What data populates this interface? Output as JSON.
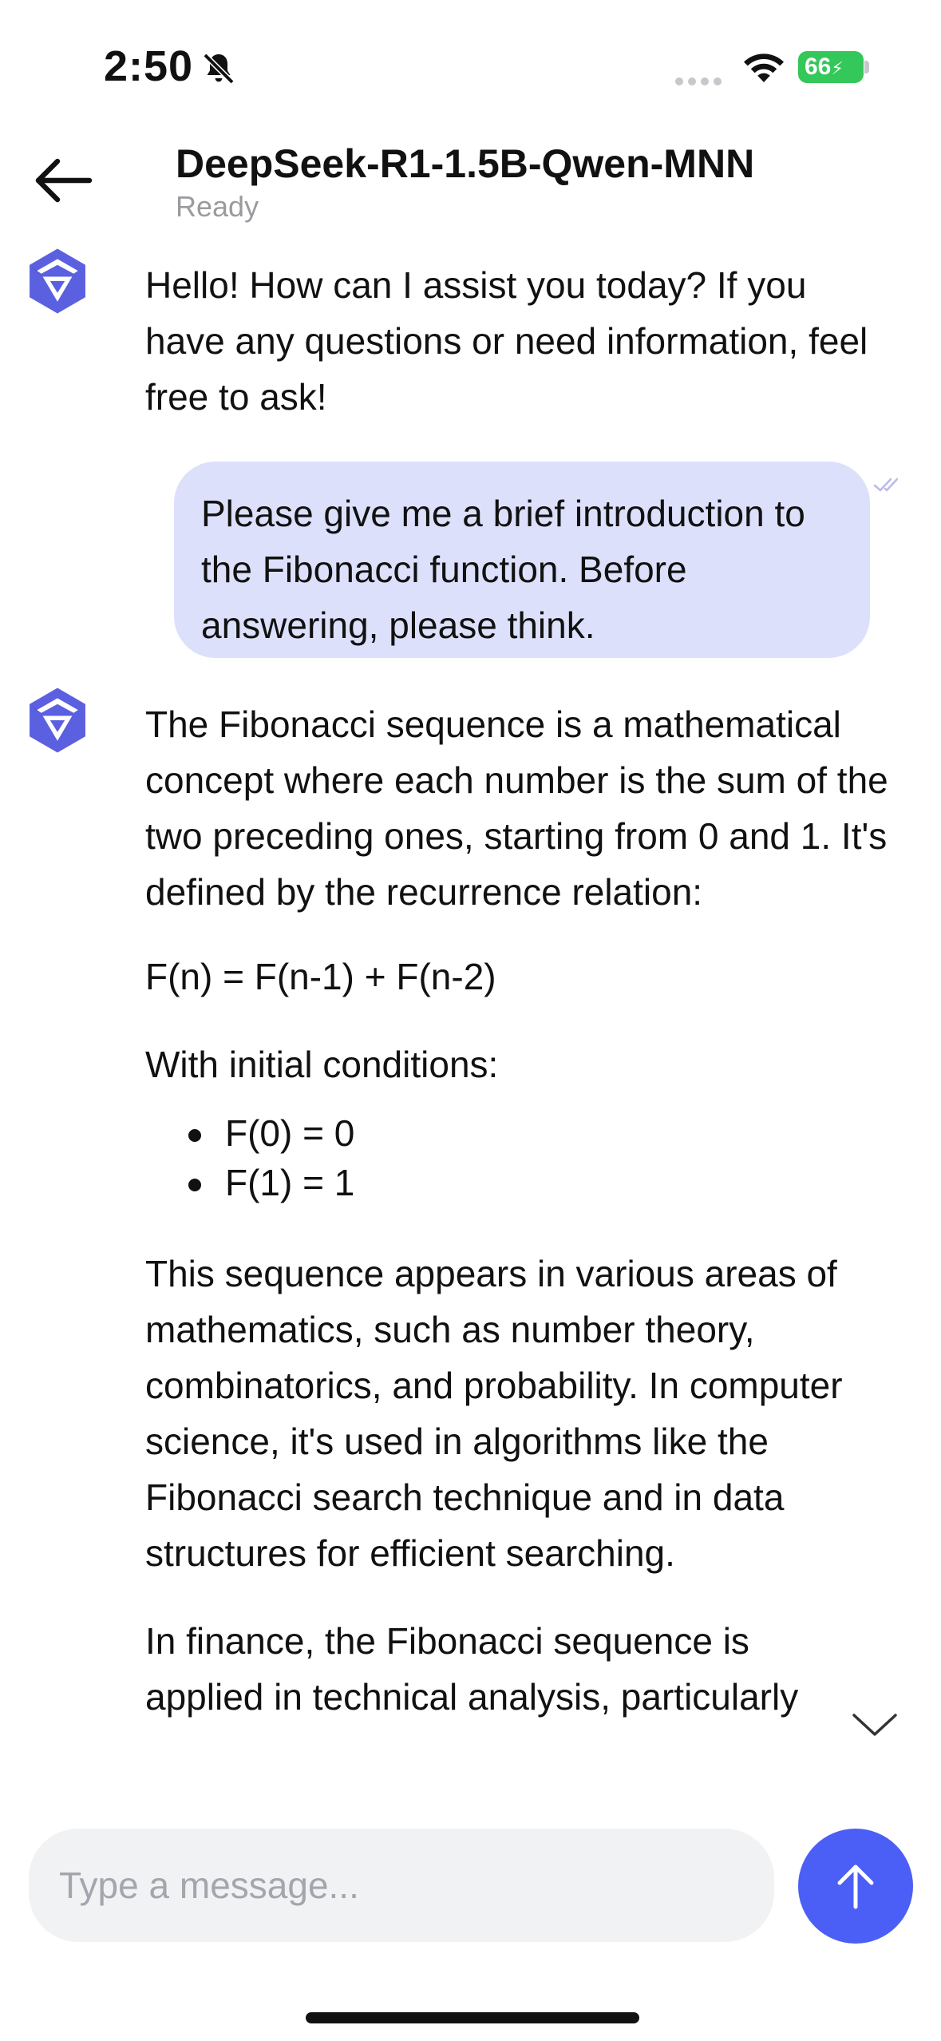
{
  "status_bar": {
    "time": "2:50",
    "battery": "66"
  },
  "header": {
    "title": "DeepSeek-R1-1.5B-Qwen-MNN",
    "subtitle": "Ready"
  },
  "messages": {
    "greeting": "Hello! How can I assist you today? If you have any questions or need information, feel free to ask!",
    "user": "Please give me a brief introduction to the Fibonacci function. Before answering, please think.",
    "answer": {
      "p1": "The Fibonacci sequence is a mathematical concept where each number is the sum of the two preceding ones, starting from 0 and 1. It's defined by the recurrence relation:",
      "formula": "F(n) = F(n-1) + F(n-2)",
      "conditions_intro": "With initial conditions:",
      "conditions": [
        "F(0) = 0",
        "F(1) = 1"
      ],
      "p2": "This sequence appears in various areas of mathematics, such as number theory, combinatorics, and probability. In computer science, it's used in algorithms like the Fibonacci search technique and in data structures for efficient searching.",
      "p3": "In finance, the Fibonacci sequence is applied in technical analysis, particularly"
    }
  },
  "composer": {
    "placeholder": "Type a message..."
  },
  "colors": {
    "accent": "#4b5ef5",
    "user_bubble": "#dde0fb",
    "battery": "#34c759"
  },
  "icons": [
    "bell-slash-icon",
    "wifi-icon",
    "back-arrow-icon",
    "qwen-logo-icon",
    "double-check-icon",
    "chevron-down-icon",
    "arrow-up-icon"
  ]
}
